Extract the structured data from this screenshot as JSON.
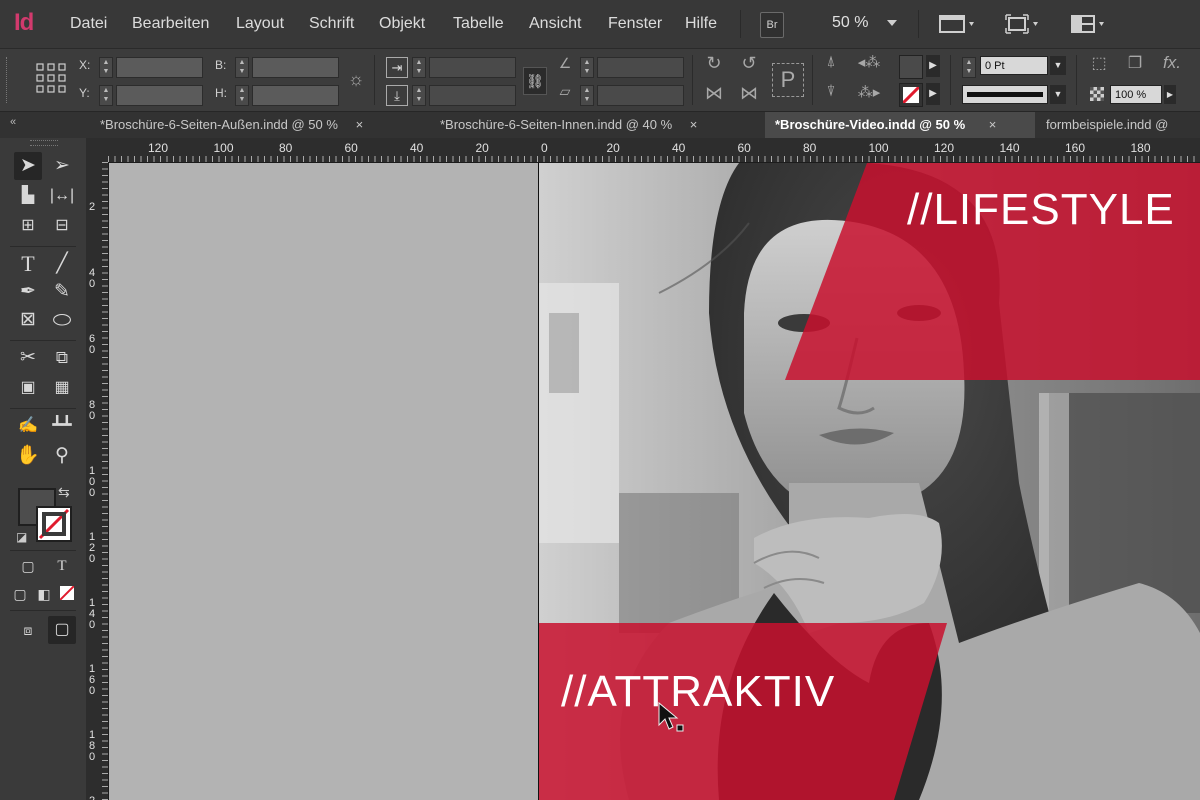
{
  "app": {
    "logo": "Id"
  },
  "menu": [
    "Datei",
    "Bearbeiten",
    "Layout",
    "Schrift",
    "Objekt",
    "Tabelle",
    "Ansicht",
    "Fenster",
    "Hilfe"
  ],
  "menubar": {
    "bridge": "Br",
    "zoom": "50 %"
  },
  "control": {
    "x_label": "X:",
    "y_label": "Y:",
    "b_label": "B:",
    "h_label": "H:",
    "stroke_weight": "0 Pt",
    "opacity": "100 %"
  },
  "tabs": [
    {
      "title": "*Broschüre-6-Seiten-Außen.indd @ 50 %",
      "close": "×",
      "active": false
    },
    {
      "title": "*Broschüre-6-Seiten-Innen.indd @ 40 %",
      "close": "×",
      "active": false
    },
    {
      "title": "*Broschüre-Video.indd @ 50 %",
      "close": "×",
      "active": true
    },
    {
      "title": "formbeispiele.indd @",
      "close": "",
      "active": false
    }
  ],
  "ruler": {
    "h_labels": [
      "120",
      "100",
      "80",
      "60",
      "40",
      "20",
      "0",
      "20",
      "40",
      "60",
      "80",
      "100",
      "120",
      "140",
      "160",
      "180"
    ],
    "v_labels": [
      "2",
      "40",
      "60",
      "80",
      "100",
      "120",
      "140",
      "160",
      "180",
      "2"
    ]
  },
  "document": {
    "headline_top": "//LIFESTYLE",
    "headline_bottom": "//ATTRAKTIV"
  },
  "colors": {
    "accent": "#c8102e",
    "indesign_pink": "#d23a6d"
  }
}
